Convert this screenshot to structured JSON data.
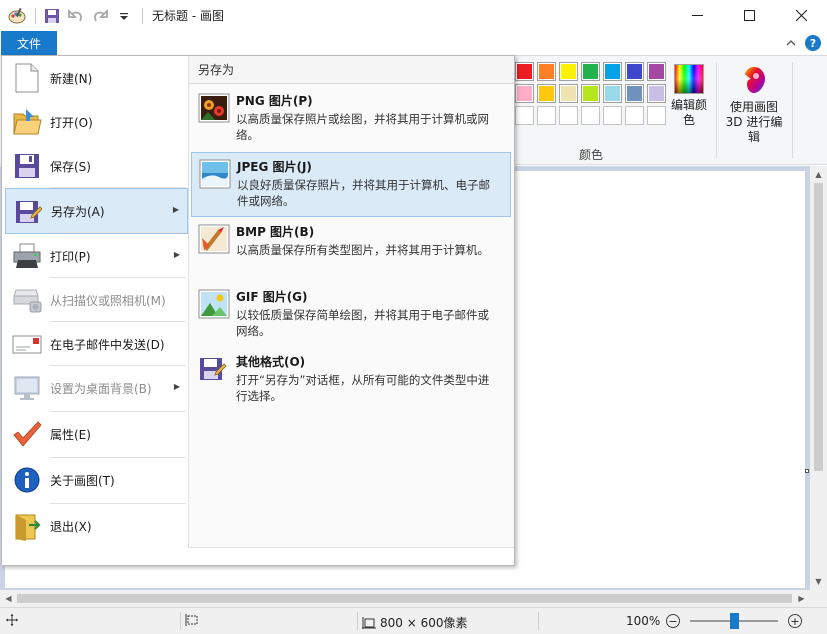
{
  "window": {
    "title": "无标题 - 画图"
  },
  "ribbon": {
    "file_tab": "文件",
    "colors_group_label": "颜色",
    "edit_colors_label": "编辑颜色",
    "paint3d_label": "使用画图 3D 进行编辑",
    "palette_row1": [
      "#ed1c24",
      "#ff7f27",
      "#fff200",
      "#22b14c",
      "#00a2e8",
      "#3f48cc",
      "#a349a4"
    ],
    "palette_row2": [
      "#ffaec9",
      "#ffc90e",
      "#efe4b0",
      "#b5e61d",
      "#99d9ea",
      "#7092be",
      "#c8bfe7"
    ],
    "palette_row3": [
      "",
      "",
      "",
      "",
      "",
      "",
      ""
    ]
  },
  "file_menu": {
    "items": [
      {
        "label": "新建(N)",
        "icon": "new-document-icon",
        "disabled": false
      },
      {
        "label": "打开(O)",
        "icon": "open-folder-icon",
        "disabled": false
      },
      {
        "label": "保存(S)",
        "icon": "save-disk-icon",
        "disabled": false
      },
      {
        "label": "另存为(A)",
        "icon": "save-as-icon",
        "disabled": false,
        "has_submenu": true,
        "active": true
      },
      {
        "label": "打印(P)",
        "icon": "printer-icon",
        "disabled": false,
        "has_submenu": true
      },
      {
        "label": "从扫描仪或照相机(M)",
        "icon": "scanner-icon",
        "disabled": true
      },
      {
        "label": "在电子邮件中发送(D)",
        "icon": "email-icon",
        "disabled": false
      },
      {
        "label": "设置为桌面背景(B)",
        "icon": "desktop-icon",
        "disabled": true,
        "has_submenu": true
      },
      {
        "label": "属性(E)",
        "icon": "checkmark-icon",
        "disabled": false
      },
      {
        "label": "关于画图(T)",
        "icon": "info-icon",
        "disabled": false
      },
      {
        "label": "退出(X)",
        "icon": "exit-icon",
        "disabled": false
      }
    ],
    "submenu": {
      "header": "另存为",
      "items": [
        {
          "title": "PNG 图片(P)",
          "desc": "以高质量保存照片或绘图，并将其用于计算机或网络。",
          "icon": "png-image-icon"
        },
        {
          "title": "JPEG 图片(J)",
          "desc": "以良好质量保存照片，并将其用于计算机、电子邮件或网络。",
          "icon": "jpeg-image-icon",
          "active": true
        },
        {
          "title": "BMP 图片(B)",
          "desc": "以高质量保存所有类型图片，并将其用于计算机。",
          "icon": "bmp-image-icon"
        },
        {
          "title": "GIF 图片(G)",
          "desc": "以较低质量保存简单绘图，并将其用于电子邮件或网络。",
          "icon": "gif-image-icon"
        },
        {
          "title": "其他格式(O)",
          "desc": "打开“另存为”对话框，从所有可能的文件类型中进行选择。",
          "icon": "other-formats-icon"
        }
      ]
    }
  },
  "statusbar": {
    "canvas_size": "800 × 600像素",
    "zoom": "100%",
    "zoom_level": 0.5
  }
}
